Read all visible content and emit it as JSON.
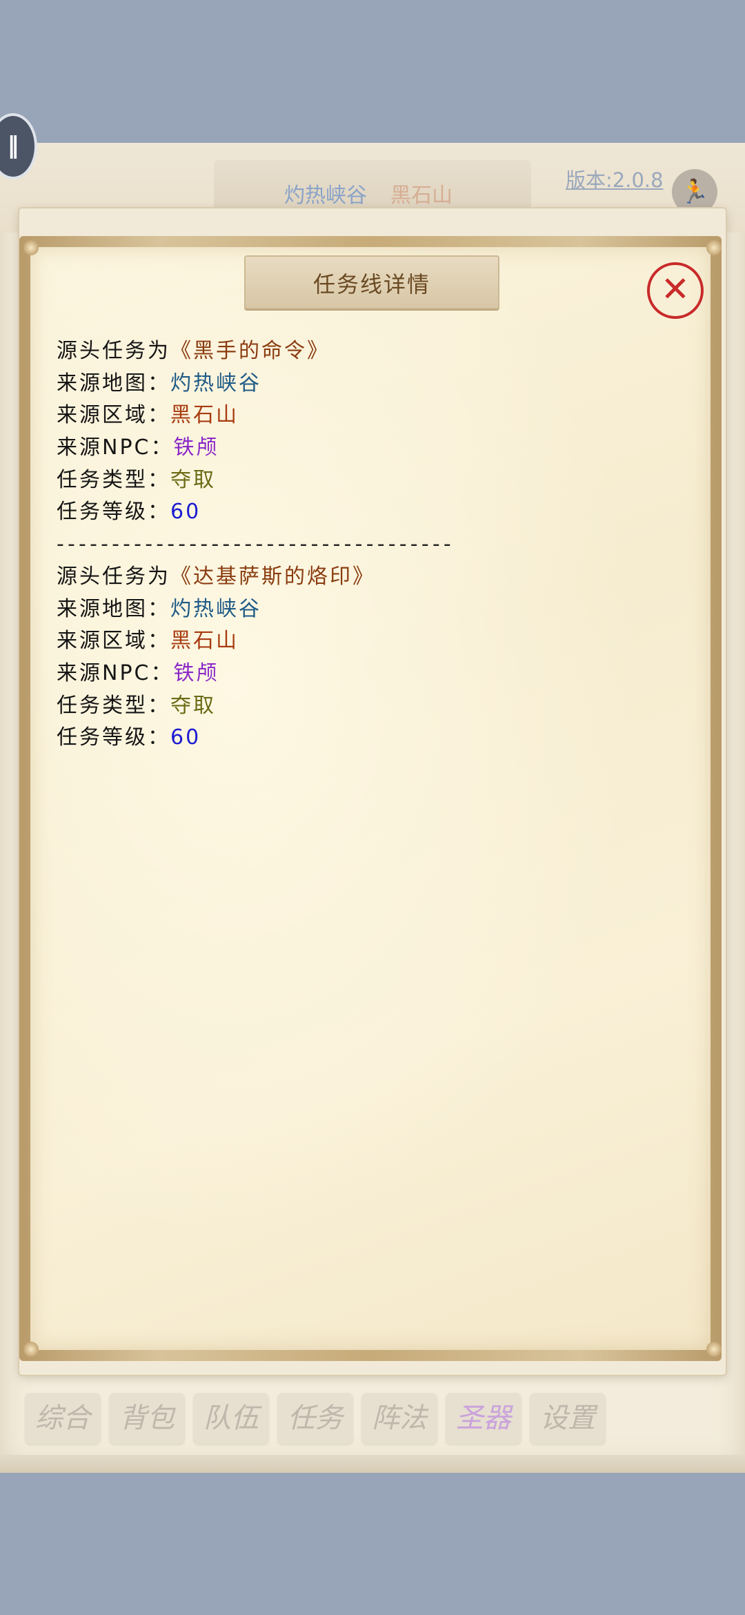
{
  "background": {
    "map_name": "灼热峡谷",
    "area_name": "黑石山",
    "version_text": "版本:2.0.8",
    "tabs": [
      {
        "label": "综合",
        "active": false
      },
      {
        "label": "背包",
        "active": false
      },
      {
        "label": "队伍",
        "active": false
      },
      {
        "label": "任务",
        "active": false
      },
      {
        "label": "阵法",
        "active": false
      },
      {
        "label": "圣器",
        "active": true
      },
      {
        "label": "设置",
        "active": false
      }
    ]
  },
  "modal": {
    "title": "任务线详情",
    "close_icon": "close-icon",
    "separator": "------------------------------------",
    "entries": [
      {
        "source_label": "源头任务为",
        "quest_name": "《黑手的命令》",
        "map_label": "来源地图：",
        "map": "灼热峡谷",
        "area_label": "来源区域：",
        "area": "黑石山",
        "npc_label": "来源NPC：",
        "npc": "铁颅",
        "type_label": "任务类型：",
        "type": "夺取",
        "level_label": "任务等级：",
        "level": "60"
      },
      {
        "source_label": "源头任务为",
        "quest_name": "《达基萨斯的烙印》",
        "map_label": "来源地图：",
        "map": "灼热峡谷",
        "area_label": "来源区域：",
        "area": "黑石山",
        "npc_label": "来源NPC：",
        "npc": "铁颅",
        "type_label": "任务类型：",
        "type": "夺取",
        "level_label": "任务等级：",
        "level": "60"
      }
    ]
  },
  "colors": {
    "quest": "#8a3c10",
    "map": "#1e5a86",
    "area": "#a73c10",
    "npc": "#8a28c8",
    "type": "#6b6a14",
    "level": "#1b1bd0",
    "close": "#c82a2a"
  },
  "icons": {
    "pause": "pause-icon",
    "run": "run-icon"
  }
}
